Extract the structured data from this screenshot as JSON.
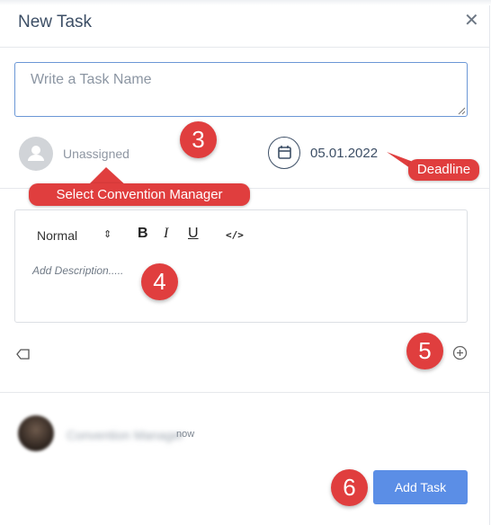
{
  "header": {
    "title": "New Task",
    "close_symbol": "✕"
  },
  "task_name": {
    "placeholder": "Write a Task Name",
    "value": ""
  },
  "assignee": {
    "label": "Unassigned"
  },
  "deadline": {
    "date": "05.01.2022"
  },
  "editor": {
    "format_select": "Normal",
    "format_caret": "⇕",
    "bold_label": "B",
    "italic_label": "I",
    "underline_label": "U",
    "code_label": "</>",
    "placeholder": "Add Description....."
  },
  "comment": {
    "author": "Convention Manager",
    "time": "now"
  },
  "footer": {
    "add_task_label": "Add Task"
  },
  "annotations": {
    "select_manager": "Select Convention Manager",
    "deadline": "Deadline",
    "step3": "3",
    "step4": "4",
    "step5": "5",
    "step6": "6"
  },
  "colors": {
    "accent": "#5b8ee6",
    "annotation": "#e03e3e",
    "title": "#3d4f66"
  }
}
